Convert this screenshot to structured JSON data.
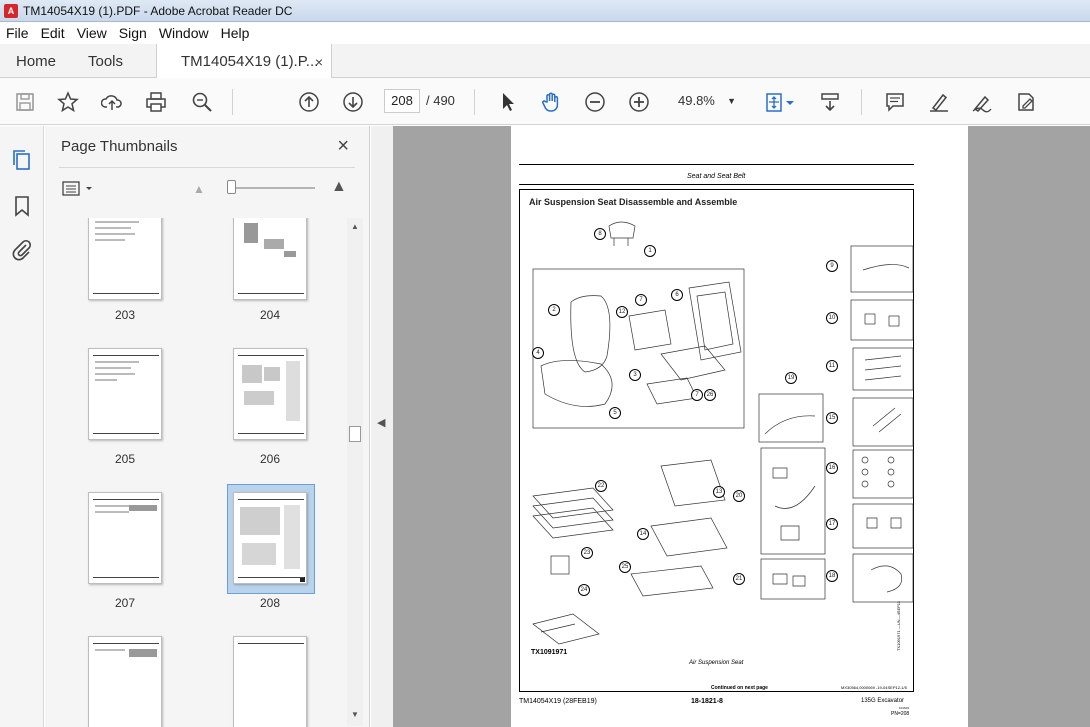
{
  "window": {
    "title": "TM14054X19 (1).PDF - Adobe Acrobat Reader DC",
    "app_icon": "acrobat-icon"
  },
  "menu": [
    "File",
    "Edit",
    "View",
    "Sign",
    "Window",
    "Help"
  ],
  "tabs": {
    "home": "Home",
    "tools": "Tools",
    "doc": "TM14054X19 (1).P...",
    "close": "×"
  },
  "toolbar": {
    "page_current": "208",
    "page_total": "/ 490",
    "zoom": "49.8%",
    "icons": [
      "save-icon",
      "bookmark-star-icon",
      "upload-icon",
      "print-icon",
      "zoom-search-icon",
      "prev-page-icon",
      "next-page-icon",
      "select-cursor-icon",
      "hand-tool-icon",
      "zoom-out-icon",
      "zoom-in-icon",
      "fit-page-icon",
      "scroll-mode-icon",
      "comment-icon",
      "highlight-icon",
      "sign-icon",
      "edit-pdf-icon"
    ]
  },
  "thumbnails": {
    "title": "Page Thumbnails",
    "close": "×",
    "pages": [
      "203",
      "204",
      "205",
      "206",
      "207",
      "208"
    ],
    "selected": "208"
  },
  "document": {
    "section_header": "Seat and Seat Belt",
    "heading": "Air Suspension Seat Disassemble and Assemble",
    "figure_id": "TX1091971",
    "caption": "Air Suspension Seat",
    "continued": "Continued on next page",
    "code_ref": "MX30564,0000069 -19-04SEP12-1/5",
    "footer_left": "TM14054X19 (28FEB19)",
    "footer_center": "18-1821-8",
    "footer_right": "135G Excavator",
    "footer_right_sub": "101619",
    "footer_pn": "PN=208",
    "side_code": "TX1091971 —UN—4SEP11",
    "callouts": [
      "1",
      "2",
      "3",
      "4",
      "5",
      "6",
      "7",
      "8",
      "9",
      "10",
      "11",
      "12",
      "13",
      "14",
      "15",
      "16",
      "17",
      "18",
      "19",
      "20",
      "21",
      "22",
      "23",
      "24",
      "25",
      "7",
      "26"
    ]
  },
  "colors": {
    "accent": "#2a6fc9",
    "selected_thumb": "#b9d3ec",
    "doc_bg": "#a3a3a3"
  }
}
